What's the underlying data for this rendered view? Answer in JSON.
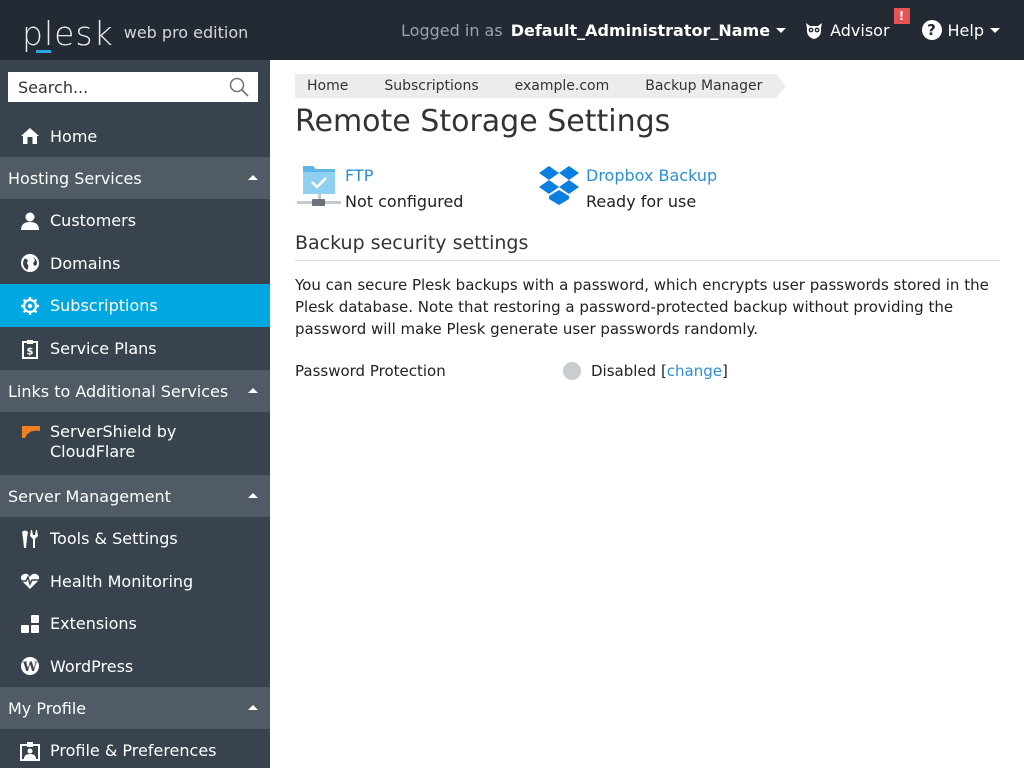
{
  "header": {
    "logo_text": "plesk",
    "edition": "web pro edition",
    "logged_in_label": "Logged in as",
    "user_name": "Default_Administrator_Name",
    "advisor_label": "Advisor",
    "advisor_badge": "!",
    "help_label": "Help"
  },
  "sidebar": {
    "search_placeholder": "Search...",
    "home": "Home",
    "sections": [
      {
        "title": "Hosting Services",
        "items": [
          "Customers",
          "Domains",
          "Subscriptions",
          "Service Plans"
        ]
      },
      {
        "title": "Links to Additional Services",
        "items": [
          "ServerShield by CloudFlare"
        ]
      },
      {
        "title": "Server Management",
        "items": [
          "Tools & Settings",
          "Health Monitoring",
          "Extensions",
          "WordPress"
        ]
      },
      {
        "title": "My Profile",
        "items": [
          "Profile & Preferences"
        ]
      }
    ],
    "servershield_line1": "ServerShield by",
    "servershield_line2": "CloudFlare",
    "active_item": "Subscriptions"
  },
  "breadcrumb": [
    "Home",
    "Subscriptions",
    "example.com",
    "Backup Manager"
  ],
  "page_title": "Remote Storage Settings",
  "storages": [
    {
      "name": "FTP",
      "status": "Not configured",
      "icon": "ftp-folder-icon"
    },
    {
      "name": "Dropbox Backup",
      "status": "Ready for use",
      "icon": "dropbox-icon"
    }
  ],
  "security": {
    "title": "Backup security settings",
    "description": "You can secure Plesk backups with a password, which encrypts user passwords stored in the Plesk database. Note that restoring a password-protected backup without providing the password will make Plesk generate user passwords randomly.",
    "password_protection_label": "Password Protection",
    "password_protection_value": "Disabled",
    "change_link": "change"
  },
  "colors": {
    "accent": "#00a7e1",
    "link": "#2c8fd6",
    "header_bg": "#232a33",
    "sidebar_bg": "#39434d",
    "section_bg": "#505b65"
  }
}
